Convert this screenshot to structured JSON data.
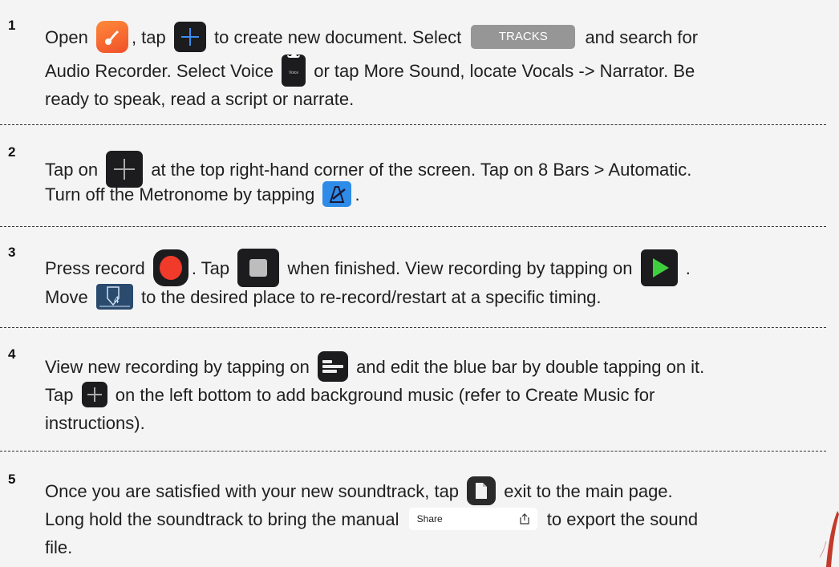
{
  "steps": [
    {
      "number": "1",
      "line1": [
        "Open",
        ", tap",
        "to create new document. Select",
        "and search for"
      ],
      "tracks_label": "TRACKS",
      "line2": [
        "Audio Recorder. Select Voice",
        "or tap More Sound, locate Vocals -> Narrator. Be"
      ],
      "voice_icon_label": "Voice",
      "line3": "ready to speak, read a script or narrate."
    },
    {
      "number": "2",
      "line1": [
        "Tap on",
        "at the top right-hand corner of the screen. Tap on 8 Bars > Automatic."
      ],
      "line2": [
        "Turn off the Metronome by tapping",
        "."
      ]
    },
    {
      "number": "3",
      "line1": [
        "Press record",
        ". Tap",
        "when finished. View recording by tapping on",
        "."
      ],
      "line2": [
        "Move",
        "to the desired place to re-record/restart at a specific timing."
      ],
      "playhead_number": "4"
    },
    {
      "number": "4",
      "line1": [
        "View new recording by tapping on",
        "and edit the blue bar by double tapping on it."
      ],
      "line2": [
        "Tap",
        "on the left bottom to add background music (refer to Create Music for"
      ],
      "line3": "instructions)."
    },
    {
      "number": "5",
      "line1": [
        "Once you are satisfied with your new soundtrack, tap",
        "exit to the main page."
      ],
      "line2": [
        "Long hold the soundtrack to bring the manual",
        "to export the sound"
      ],
      "share_label": "Share",
      "line3": "file."
    }
  ],
  "colors": {
    "background": "#f4f4f4",
    "plus_blue": "#3b8ef0",
    "record_red": "#f03a2a",
    "play_green": "#3ecf3e",
    "tracks_gray": "#969696",
    "metronome_blue": "#2e8ce8"
  },
  "icons": [
    "garageband-app-icon",
    "plus-icon",
    "mic-icon",
    "metronome-icon",
    "record-icon",
    "stop-icon",
    "play-icon",
    "playhead-icon",
    "tracks-view-icon",
    "document-icon",
    "share-icon"
  ]
}
